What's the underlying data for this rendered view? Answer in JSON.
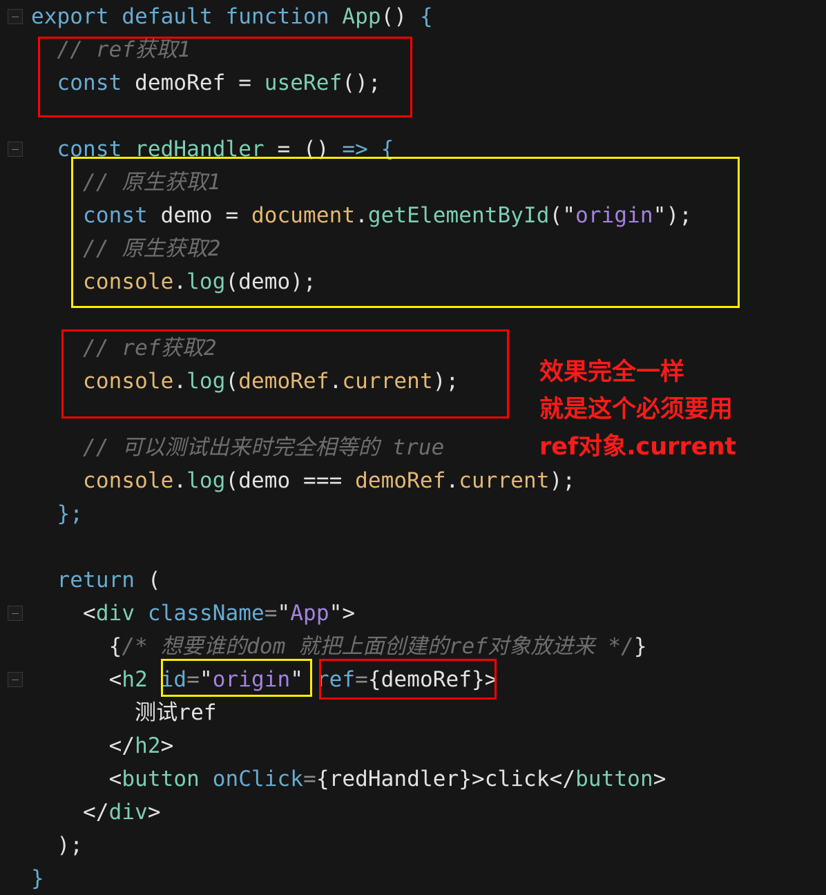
{
  "editor": {
    "lines": [
      [
        [
          "export ",
          "kw"
        ],
        [
          "default ",
          "kw"
        ],
        [
          "function ",
          "kw"
        ],
        [
          "App",
          "fn"
        ],
        [
          "() ",
          "pl"
        ],
        [
          "{",
          "kw"
        ]
      ],
      [
        [
          "  // ref获取1",
          "cm"
        ]
      ],
      [
        [
          "  const ",
          "kw"
        ],
        [
          "demoRef ",
          "pl"
        ],
        [
          "= ",
          "pl"
        ],
        [
          "useRef",
          "fn"
        ],
        [
          "();",
          "pl"
        ]
      ],
      [],
      [
        [
          "  const ",
          "kw"
        ],
        [
          "redHandler ",
          "fn"
        ],
        [
          "= () ",
          "pl"
        ],
        [
          "=> {",
          "kw"
        ]
      ],
      [
        [
          "    // 原生获取1",
          "cm"
        ]
      ],
      [
        [
          "    const ",
          "kw"
        ],
        [
          "demo ",
          "pl"
        ],
        [
          "= ",
          "pl"
        ],
        [
          "document",
          "var"
        ],
        [
          ".",
          "pl"
        ],
        [
          "getElementById",
          "fn"
        ],
        [
          "(\"",
          "pl"
        ],
        [
          "origin",
          "str"
        ],
        [
          "\");",
          "pl"
        ]
      ],
      [
        [
          "    // 原生获取2",
          "cm"
        ]
      ],
      [
        [
          "    console",
          "var"
        ],
        [
          ".",
          "pl"
        ],
        [
          "log",
          "fn"
        ],
        [
          "(demo);",
          "pl"
        ]
      ],
      [],
      [
        [
          "    // ref获取2",
          "cm"
        ]
      ],
      [
        [
          "    console",
          "var"
        ],
        [
          ".",
          "pl"
        ],
        [
          "log",
          "fn"
        ],
        [
          "(",
          "pl"
        ],
        [
          "demoRef",
          "var"
        ],
        [
          ".",
          "pl"
        ],
        [
          "current",
          "var"
        ],
        [
          ");",
          "pl"
        ]
      ],
      [],
      [
        [
          "    // 可以测试出来时完全相等的 true",
          "cm"
        ]
      ],
      [
        [
          "    console",
          "var"
        ],
        [
          ".",
          "pl"
        ],
        [
          "log",
          "fn"
        ],
        [
          "(demo === ",
          "pl"
        ],
        [
          "demoRef",
          "var"
        ],
        [
          ".",
          "pl"
        ],
        [
          "current",
          "var"
        ],
        [
          ");",
          "pl"
        ]
      ],
      [
        [
          "  };",
          "kw"
        ]
      ],
      [],
      [
        [
          "  return ",
          "kw"
        ],
        [
          "(",
          "pl"
        ]
      ],
      [
        [
          "    <",
          "pl"
        ],
        [
          "div ",
          "fn"
        ],
        [
          "className",
          "kw"
        ],
        [
          "=",
          "op"
        ],
        [
          "\"",
          "pl"
        ],
        [
          "App",
          "str"
        ],
        [
          "\">",
          "pl"
        ]
      ],
      [
        [
          "      {",
          "pl"
        ],
        [
          "/* 想要谁的dom 就把上面创建的ref对象放进来 */",
          "cm"
        ],
        [
          "}",
          "pl"
        ]
      ],
      [
        [
          "      <",
          "pl"
        ],
        [
          "h2 ",
          "fn"
        ],
        [
          "id",
          "kw"
        ],
        [
          "=",
          "op"
        ],
        [
          "\"",
          "pl"
        ],
        [
          "origin",
          "str"
        ],
        [
          "\" ",
          "pl"
        ],
        [
          "ref",
          "kw"
        ],
        [
          "=",
          "op"
        ],
        [
          "{demoRef}>",
          "pl"
        ]
      ],
      [
        [
          "        测试ref",
          "pl"
        ]
      ],
      [
        [
          "      </",
          "pl"
        ],
        [
          "h2",
          "fn"
        ],
        [
          ">",
          "pl"
        ]
      ],
      [
        [
          "      <",
          "pl"
        ],
        [
          "button ",
          "fn"
        ],
        [
          "onClick",
          "kw"
        ],
        [
          "=",
          "op"
        ],
        [
          "{redHandler}>click</",
          "pl"
        ],
        [
          "button",
          "fn"
        ],
        [
          ">",
          "pl"
        ]
      ],
      [
        [
          "    </",
          "pl"
        ],
        [
          "div",
          "fn"
        ],
        [
          ">",
          "pl"
        ]
      ],
      [
        [
          "  );",
          "pl"
        ]
      ],
      [
        [
          "}",
          "kw"
        ]
      ]
    ],
    "fold_lines": [
      0,
      4,
      18,
      20
    ]
  },
  "annotation": {
    "lines": [
      "效果完全一样",
      "就是这个必须要用",
      "ref对象.current"
    ],
    "color": "#ff1a1a"
  },
  "highlight_colors": {
    "red": "#ff0000",
    "yellow": "#ffee00"
  }
}
